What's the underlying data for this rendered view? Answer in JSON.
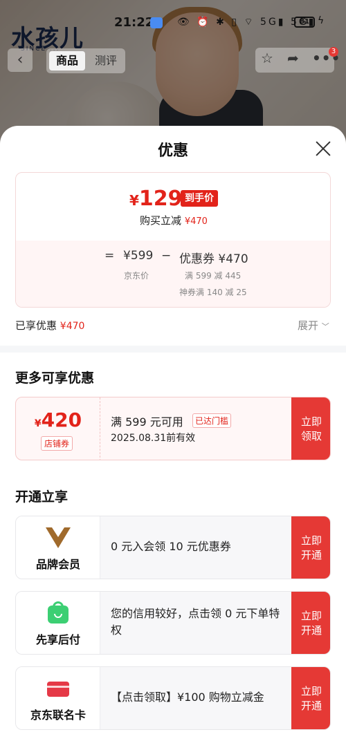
{
  "status_bar": {
    "time": "21:22",
    "battery": "81",
    "system_icons": "👁 ⏰ ✱ ▯ ⌔ 5G▮ 5G▮"
  },
  "product_page": {
    "brand_logo": "水孩儿",
    "brand_logo_sub": "SINCE ...",
    "tabs": [
      "商品",
      "测评"
    ],
    "notification_count": "3"
  },
  "sheet": {
    "title": "优惠",
    "price": {
      "currency": "¥",
      "final_price": "129",
      "final_tag": "到手价",
      "discount_label": "购买立减",
      "discount_amount": "¥470",
      "equals": "=",
      "jd_price": "¥599",
      "minus": "−",
      "coupon_label": "优惠券 ¥470",
      "jd_price_label": "京东价",
      "coupon_detail_1": "满 599 减 445",
      "coupon_detail_2": "神券满 140 减 25"
    },
    "enjoyed_label": "已享优惠",
    "enjoyed_amount": "¥470",
    "expand_label": "展开"
  },
  "more_discounts": {
    "title": "更多可享优惠",
    "coupon": {
      "currency": "¥",
      "amount": "420",
      "type": "店铺券",
      "condition": "满 599 元可用",
      "status_tag": "已达门槛",
      "expiry": "2025.08.31前有效",
      "button_line1": "立即",
      "button_line2": "领取"
    }
  },
  "activate": {
    "title": "开通立享",
    "rows": [
      {
        "label": "品牌会员",
        "text": "0 元入会领 10 元优惠券",
        "button_line1": "立即",
        "button_line2": "开通",
        "icon": "brand-v-icon"
      },
      {
        "label": "先享后付",
        "text": "您的信用较好，点击领 0 元下单特权",
        "button_line1": "立即",
        "button_line2": "开通",
        "icon": "shopping-bag-icon"
      },
      {
        "label": "京东联名卡",
        "text": "【点击领取】¥100 购物立减金",
        "button_line1": "立即",
        "button_line2": "开通",
        "icon": "credit-card-icon"
      }
    ]
  },
  "colors": {
    "accent_red": "#e2231a",
    "button_red": "#e53935",
    "member_gold": "#a06a2c",
    "pay_green": "#3ccf73"
  }
}
